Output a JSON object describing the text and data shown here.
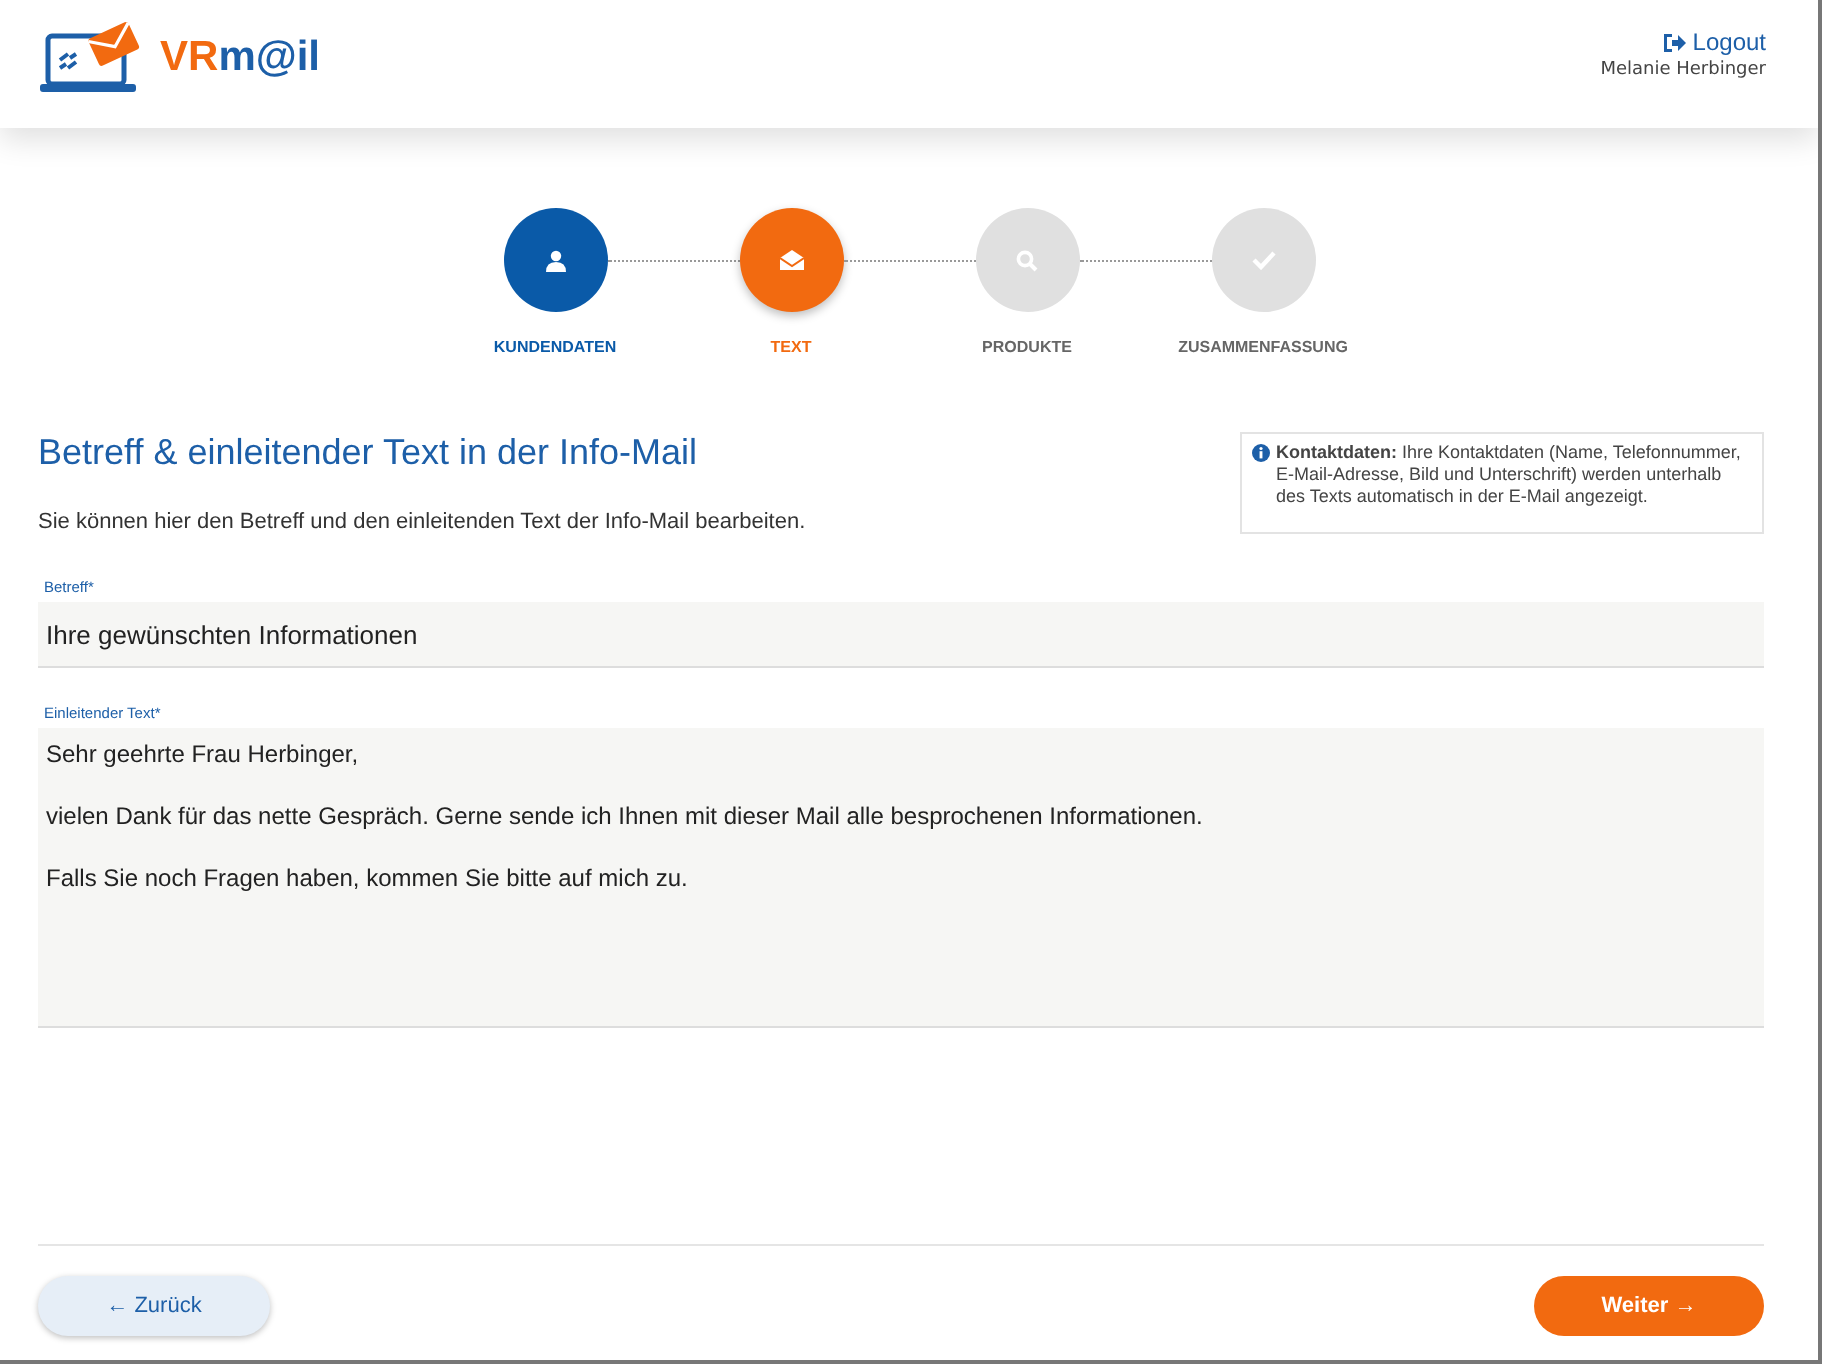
{
  "header": {
    "logo": {
      "prefix": "VR",
      "suffix": "m@il"
    },
    "logout": "Logout",
    "user": "Melanie Herbinger"
  },
  "steps": [
    {
      "label": "KUNDENDATEN",
      "completed": true,
      "selected": false,
      "kind": "person"
    },
    {
      "label": "TEXT",
      "completed": false,
      "selected": true,
      "kind": "envelope"
    },
    {
      "label": "PRODUKTE",
      "completed": false,
      "selected": false,
      "kind": "search"
    },
    {
      "label": "ZUSAMMENFASSUNG",
      "completed": false,
      "selected": false,
      "kind": "check"
    }
  ],
  "title": "Betreff & einleitender Text in der Info-Mail",
  "subtitle": "Sie können hier den Betreff und den einleitenden Text der Info-Mail bearbeiten.",
  "info": "**Kontaktdaten:** Ihre Kontaktdaten (Name, Telefonnummer, E-Mail-Adresse, Bild und Unterschrift) werden unterhalb des Texts automatisch in der E-Mail angezeigt.",
  "subject": {
    "label": "Betreff*",
    "value": "Ihre gewünschten Informationen"
  },
  "intro": {
    "label": "Einleitender Text*",
    "paragraphs": [
      "Sehr geehrte Frau Herbinger,",
      "vielen Dank für das nette Gespräch. Gerne sende ich Ihnen mit dieser Mail alle besprochenen Informationen.",
      "Falls Sie noch Fragen haben, kommen Sie bitte auf mich zu."
    ]
  },
  "buttons": {
    "back": "← Zurück",
    "next": "Weiter →"
  }
}
